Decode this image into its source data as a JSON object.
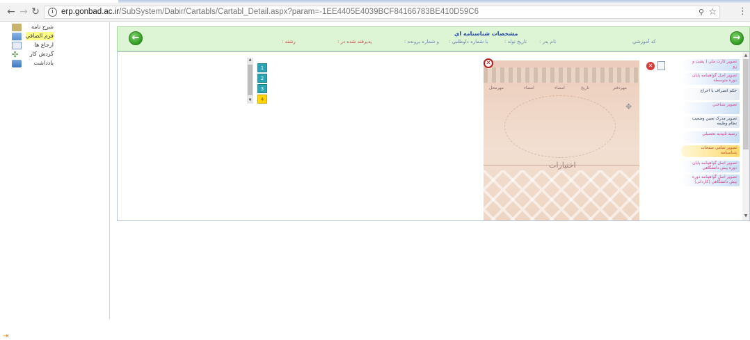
{
  "browser": {
    "url_host": "erp.gonbad.ac.ir",
    "url_path": "/SubSystem/Dabir/Cartabls/Cartabl_Detail.aspx?param=-1EE4405E4039BCF84166783BE410D59C6",
    "back_icon": "arrow-left-icon",
    "forward_icon": "arrow-right-icon",
    "reload_icon": "reload-icon"
  },
  "sidebar": {
    "items": [
      {
        "label": "شرح نامه",
        "icon": "folder-icon"
      },
      {
        "label": "فرم الصاقي",
        "icon": "folder-icon",
        "highlighted": true
      },
      {
        "label": "ارجاع ها",
        "icon": "document-icon"
      },
      {
        "label": "گردش کار",
        "icon": "workflow-icon"
      },
      {
        "label": "يادداشت",
        "icon": "note-icon"
      }
    ]
  },
  "header": {
    "title": "مشخصات شناسنامه اي",
    "fields": [
      "کد آموزشي",
      "نام پدر :",
      "تاريخ تولد :",
      "با شماره داوطلبي :",
      "و شماره پرونده :",
      "پذيرفته شده در :",
      "رشته :"
    ]
  },
  "doc_tabs": [
    {
      "label": "تصوير کارت ملي ( پشت و رو",
      "style": "blue"
    },
    {
      "label": "تصوير اصل گواهينامه پايان دوره متوسطه",
      "style": "blue"
    },
    {
      "label": "حکم انصراف يا اخراج",
      "style": "plain"
    },
    {
      "label": "تصوير شناختي",
      "style": "blue"
    },
    {
      "label": "تصوير مدرک تعيين وضعيت نظام وظيفه",
      "style": "plain"
    },
    {
      "label": "رسيد تاييديه تحصيلي",
      "style": "blue"
    },
    {
      "label": "تصوير تمامي صفحات شناسنامه",
      "style": "active"
    },
    {
      "label": "تصوير اصل گواهينامه پايان دوره پيش دانشگاهي",
      "style": "blue"
    },
    {
      "label": "تصوير اصل گواهينامه دوره پيش دانشگاهي (کاردانی)",
      "style": "blue"
    }
  ],
  "pager": {
    "pages": [
      "1",
      "2",
      "3",
      "4"
    ],
    "active_index": 3
  },
  "document_image": {
    "stamp_text": "اختيارات",
    "labels": [
      "مهرمحل",
      "امضاء",
      "امضاء",
      "تاريخ",
      "مهردفتر"
    ]
  }
}
